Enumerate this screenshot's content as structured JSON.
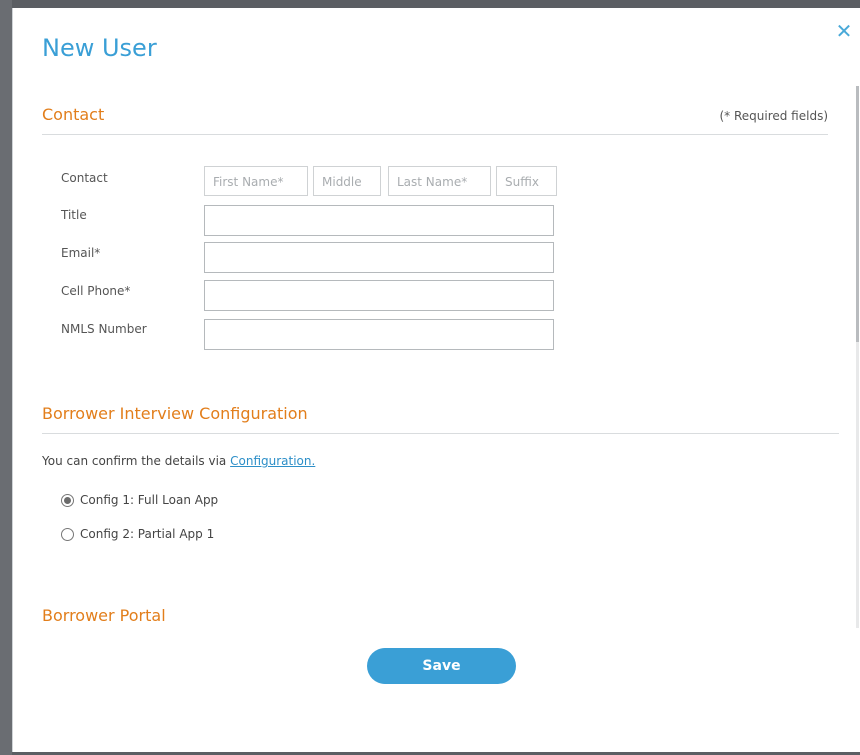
{
  "modal": {
    "title": "New User",
    "close_icon": "close-icon"
  },
  "contact": {
    "heading": "Contact",
    "required_note": "(* Required fields)",
    "fields": {
      "contact_label": "Contact",
      "first_name_placeholder": "First Name*",
      "middle_placeholder": "Middle",
      "last_name_placeholder": "Last Name*",
      "suffix_placeholder": "Suffix",
      "title_label": "Title",
      "title_value": "",
      "email_label": "Email*",
      "email_value": "",
      "cell_label": "Cell Phone*",
      "cell_value": "",
      "nmls_label": "NMLS Number",
      "nmls_value": ""
    }
  },
  "interview": {
    "heading": "Borrower Interview Configuration",
    "info_text": "You can confirm the details via",
    "info_link": "Configuration.",
    "options": [
      {
        "label": "Config 1: Full Loan App",
        "selected": true
      },
      {
        "label": "Config 2: Partial App 1",
        "selected": false
      }
    ]
  },
  "portal": {
    "heading": "Borrower Portal"
  },
  "actions": {
    "save_label": "Save"
  },
  "colors": {
    "accent": "#3a9fd6",
    "section_heading": "#e27e1b",
    "backdrop": "#5b5e63"
  }
}
